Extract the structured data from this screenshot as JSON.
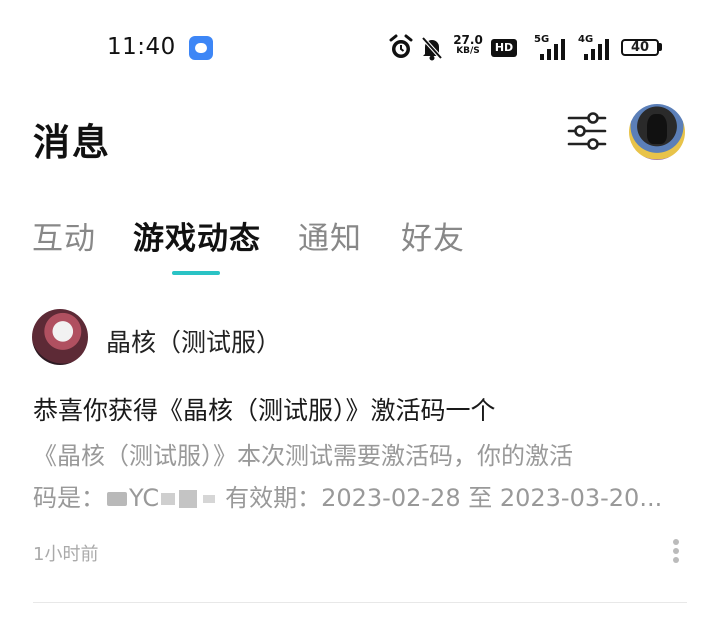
{
  "status_bar": {
    "time": "11:40",
    "net_speed_value": "27.0",
    "net_speed_unit": "KB/S",
    "hd_label": "HD",
    "signal_1_label": "5G",
    "signal_2_label": "4G",
    "battery": "40",
    "icons": [
      "app-notification-icon",
      "alarm-icon",
      "bell-muted-icon",
      "hd-icon",
      "signal-icon",
      "battery-icon"
    ]
  },
  "header": {
    "title": "消息",
    "filter_icon": "sliders-icon",
    "avatar_icon": "user-avatar"
  },
  "tabs": [
    {
      "label": "互动",
      "active": false
    },
    {
      "label": "游戏动态",
      "active": true
    },
    {
      "label": "通知",
      "active": false
    },
    {
      "label": "好友",
      "active": false
    }
  ],
  "accent_color": "#2ac3c5",
  "message": {
    "sender": "晶核（测试服）",
    "title": "恭喜你获得《晶核（测试服）》激活码一个",
    "body_line1": "《晶核（测试服）》本次测试需要激活码，你的激活",
    "body_line2_prefix": "码是：",
    "body_line2_code_visible": "YC",
    "body_line2_suffix": "有效期：2023-02-28 至 2023-03-20...",
    "time": "1小时前",
    "more_icon": "more-vertical-icon"
  }
}
